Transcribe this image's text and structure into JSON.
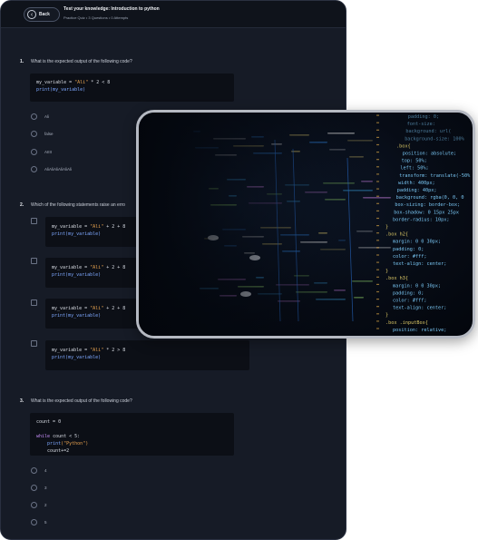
{
  "header": {
    "back_label": "Back",
    "title": "Test your knowledge: Introduction to python",
    "subtitle": "Practice Quiz • 3 Questions • 0 Attempts"
  },
  "questions": [
    {
      "number": "1.",
      "text": "What is the expected output of the following code?",
      "code_line1_a": "my_variable = ",
      "code_line1_str": "\"Ali\"",
      "code_line1_b": " * 2 < 8",
      "code_line2": "print(my_variable)",
      "options": [
        "Ali",
        "false",
        "AIIII",
        "AliAliAliAliAliAli"
      ]
    },
    {
      "number": "2.",
      "text": "Which of the following statements raise an erro",
      "option_codes": [
        {
          "a": "my_variable = ",
          "s": "\"Ali\"",
          "b": " + 2 + 8",
          "p": "print(my_variable)"
        },
        {
          "a": "my_variable = ",
          "s": "\"Ali\"",
          "b": " + 2 + 8",
          "p": "print(my_variable)"
        },
        {
          "a": "my_variable = ",
          "s": "\"Ali\"",
          "b": " + 2 + 8",
          "p": "print(my_variable)"
        },
        {
          "a": "my_variable = ",
          "s": "\"Ali\"",
          "b": " * 2 > 8",
          "p": "print(my_variable)"
        }
      ]
    },
    {
      "number": "3.",
      "text": "What is the expected output of the following code?",
      "code": {
        "l1": "count = 0",
        "l2_kw": "while",
        "l2_rest": " count < 5:",
        "l3_fn": "print",
        "l3_str": "(\"Python\")",
        "l4": "count+=2"
      },
      "options": [
        "4",
        "3",
        "2",
        "5"
      ]
    }
  ],
  "colors": {
    "window_bg": "#161b26",
    "code_bg": "#0c0f16",
    "string": "#e7a24f",
    "function": "#7ea8ff",
    "keyword": "#c48cf5"
  },
  "photo": {
    "lines": [
      "padding: 0;",
      "font-size:",
      "background: url(",
      "background-size: 100%",
      ".box{",
      "position: absolute;",
      "top: 50%;",
      "left: 50%;",
      "transform: translate(-50%",
      "width: 400px;",
      "padding: 40px;",
      "background: rgba(0, 0, 0",
      "box-sizing: border-box;",
      "box-shadow: 0 15px 25px",
      "border-radius: 10px;",
      "}",
      ".box h2{",
      "margin: 0 0 30px;",
      "padding: 0;",
      "color: #fff;",
      "text-align: center;",
      "}",
      ".box h3{",
      "margin: 0 0 30px;",
      "padding: 0;",
      "color: #fff;",
      "text-align: center;",
      "}",
      ".box .inputBox{",
      "position: relative;"
    ]
  }
}
